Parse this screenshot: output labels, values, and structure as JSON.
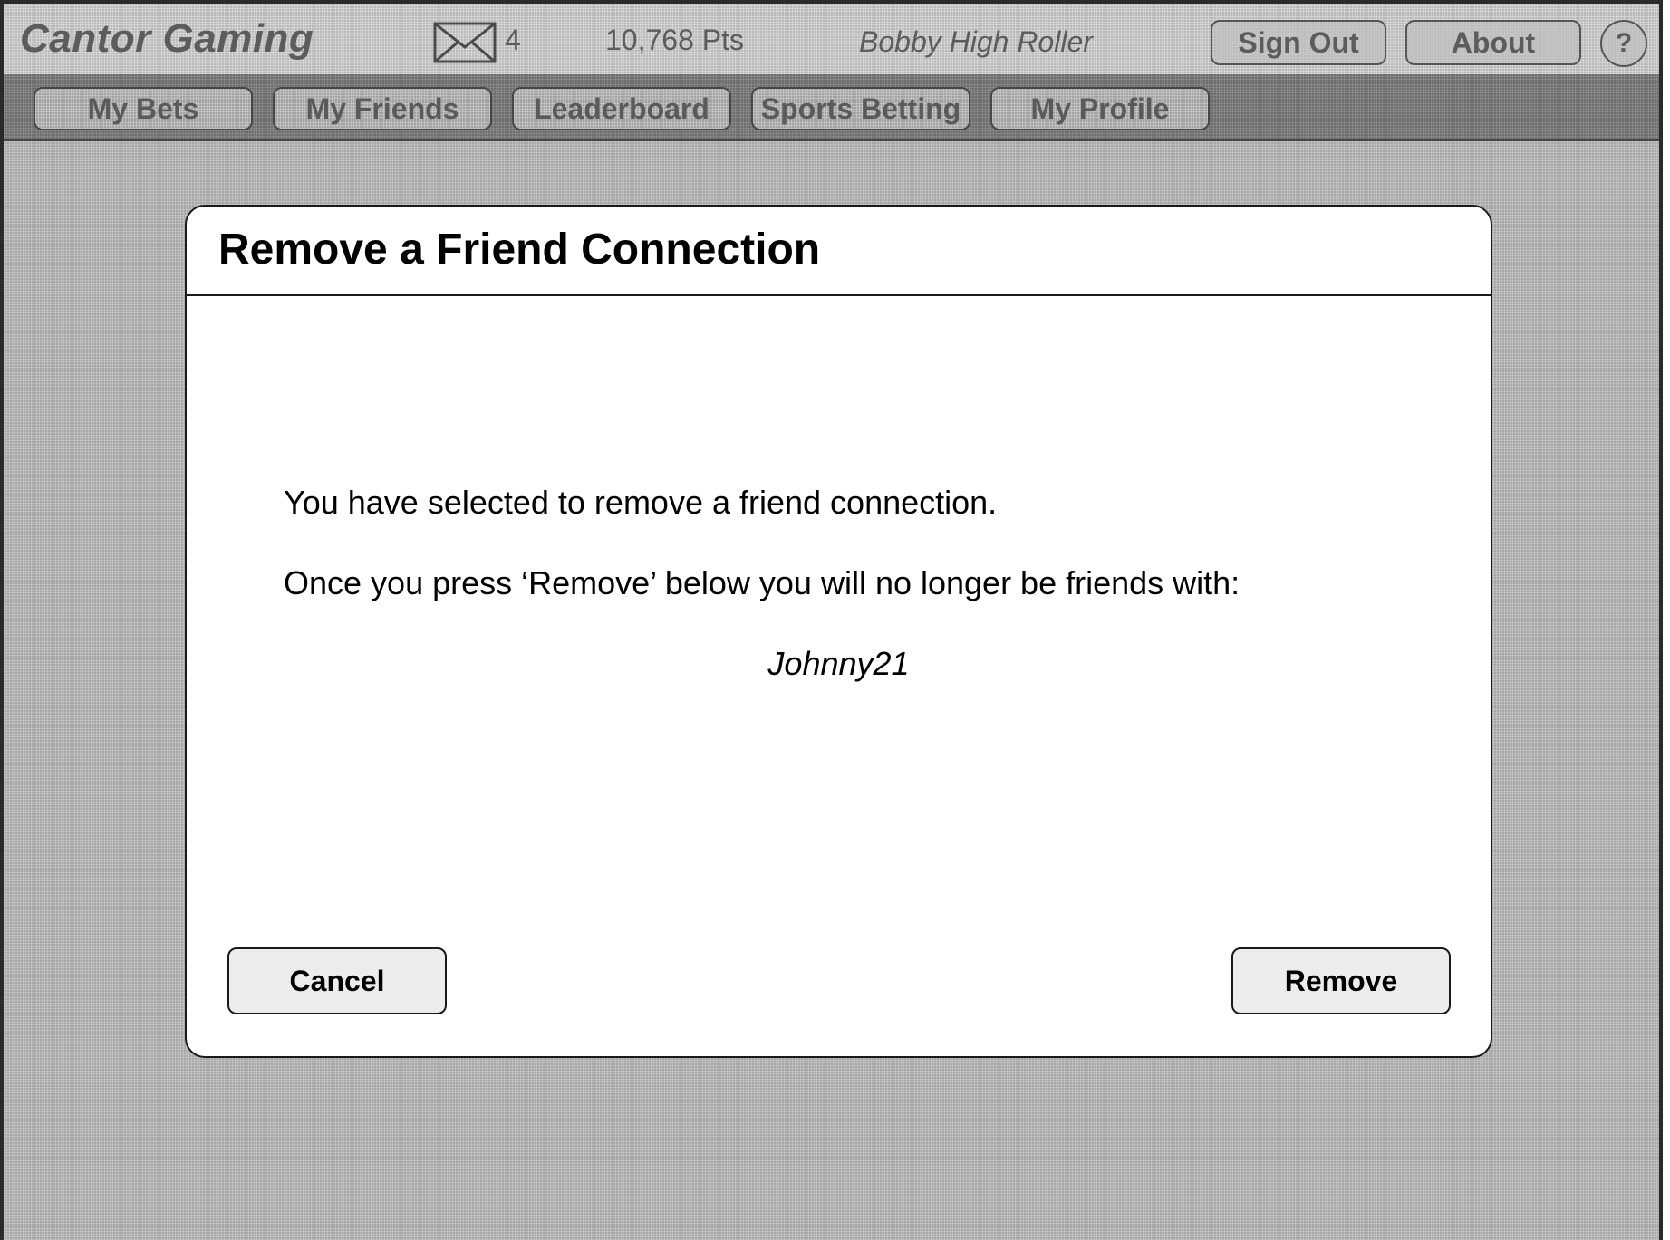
{
  "header": {
    "brand": "Cantor Gaming",
    "message_count": "4",
    "points": "10,768 Pts",
    "user_name": "Bobby High Roller",
    "sign_out_label": "Sign Out",
    "about_label": "About",
    "help_label": "?"
  },
  "icons": {
    "mail": "envelope-icon"
  },
  "nav": {
    "tabs": [
      {
        "label": "My Bets"
      },
      {
        "label": "My Friends"
      },
      {
        "label": "Leaderboard"
      },
      {
        "label": "Sports Betting"
      },
      {
        "label": "My Profile"
      }
    ]
  },
  "dialog": {
    "title": "Remove a Friend Connection",
    "message_1": "You have selected to remove a friend connection.",
    "message_2": "Once you press ‘Remove’ below you will no longer be friends with:",
    "friend_name": "Johnny21",
    "cancel_label": "Cancel",
    "remove_label": "Remove"
  }
}
